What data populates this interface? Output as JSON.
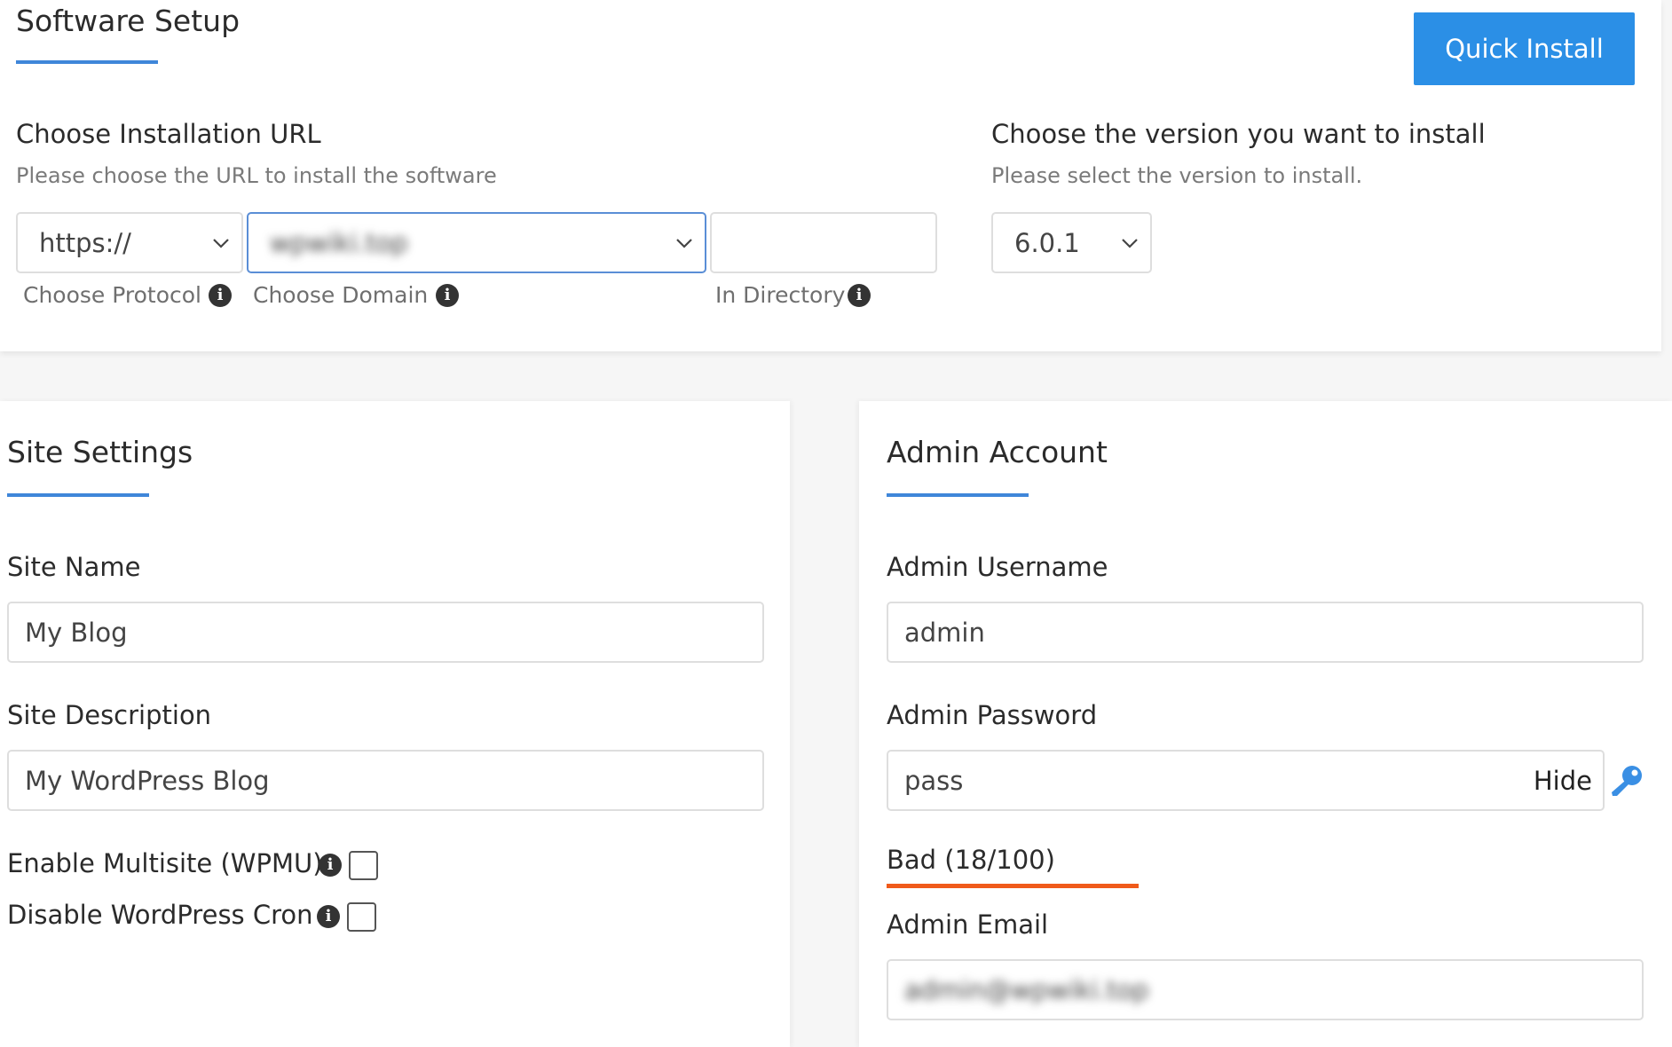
{
  "software_setup": {
    "title": "Software Setup",
    "quick_install_label": "Quick Install",
    "install_url": {
      "heading": "Choose Installation URL",
      "subheading": "Please choose the URL to install the software",
      "protocol_value": "https://",
      "protocol_label": "Choose Protocol",
      "domain_value": "wpwiki.top",
      "domain_label": "Choose Domain",
      "directory_value": "",
      "directory_label": "In Directory"
    },
    "version": {
      "heading": "Choose the version you want to install",
      "subheading": "Please select the version to install.",
      "value": "6.0.1"
    }
  },
  "site_settings": {
    "title": "Site Settings",
    "site_name_label": "Site Name",
    "site_name_value": "My Blog",
    "site_description_label": "Site Description",
    "site_description_value": "My WordPress Blog",
    "multisite_label": "Enable Multisite (WPMU)",
    "multisite_checked": false,
    "cron_label": "Disable WordPress Cron",
    "cron_checked": false
  },
  "admin_account": {
    "title": "Admin Account",
    "username_label": "Admin Username",
    "username_value": "admin",
    "password_label": "Admin Password",
    "password_value": "pass",
    "hide_label": "Hide",
    "strength_text": "Bad (18/100)",
    "strength_score": 18,
    "email_label": "Admin Email",
    "email_value": "admin@wpwiki.top"
  },
  "colors": {
    "accent": "#3f86d9",
    "button": "#2b8fe6",
    "strength_bad": "#f05a1a",
    "key_icon": "#3a8fe4"
  },
  "icons": [
    "chevron-down-icon",
    "info-icon",
    "key-icon"
  ]
}
